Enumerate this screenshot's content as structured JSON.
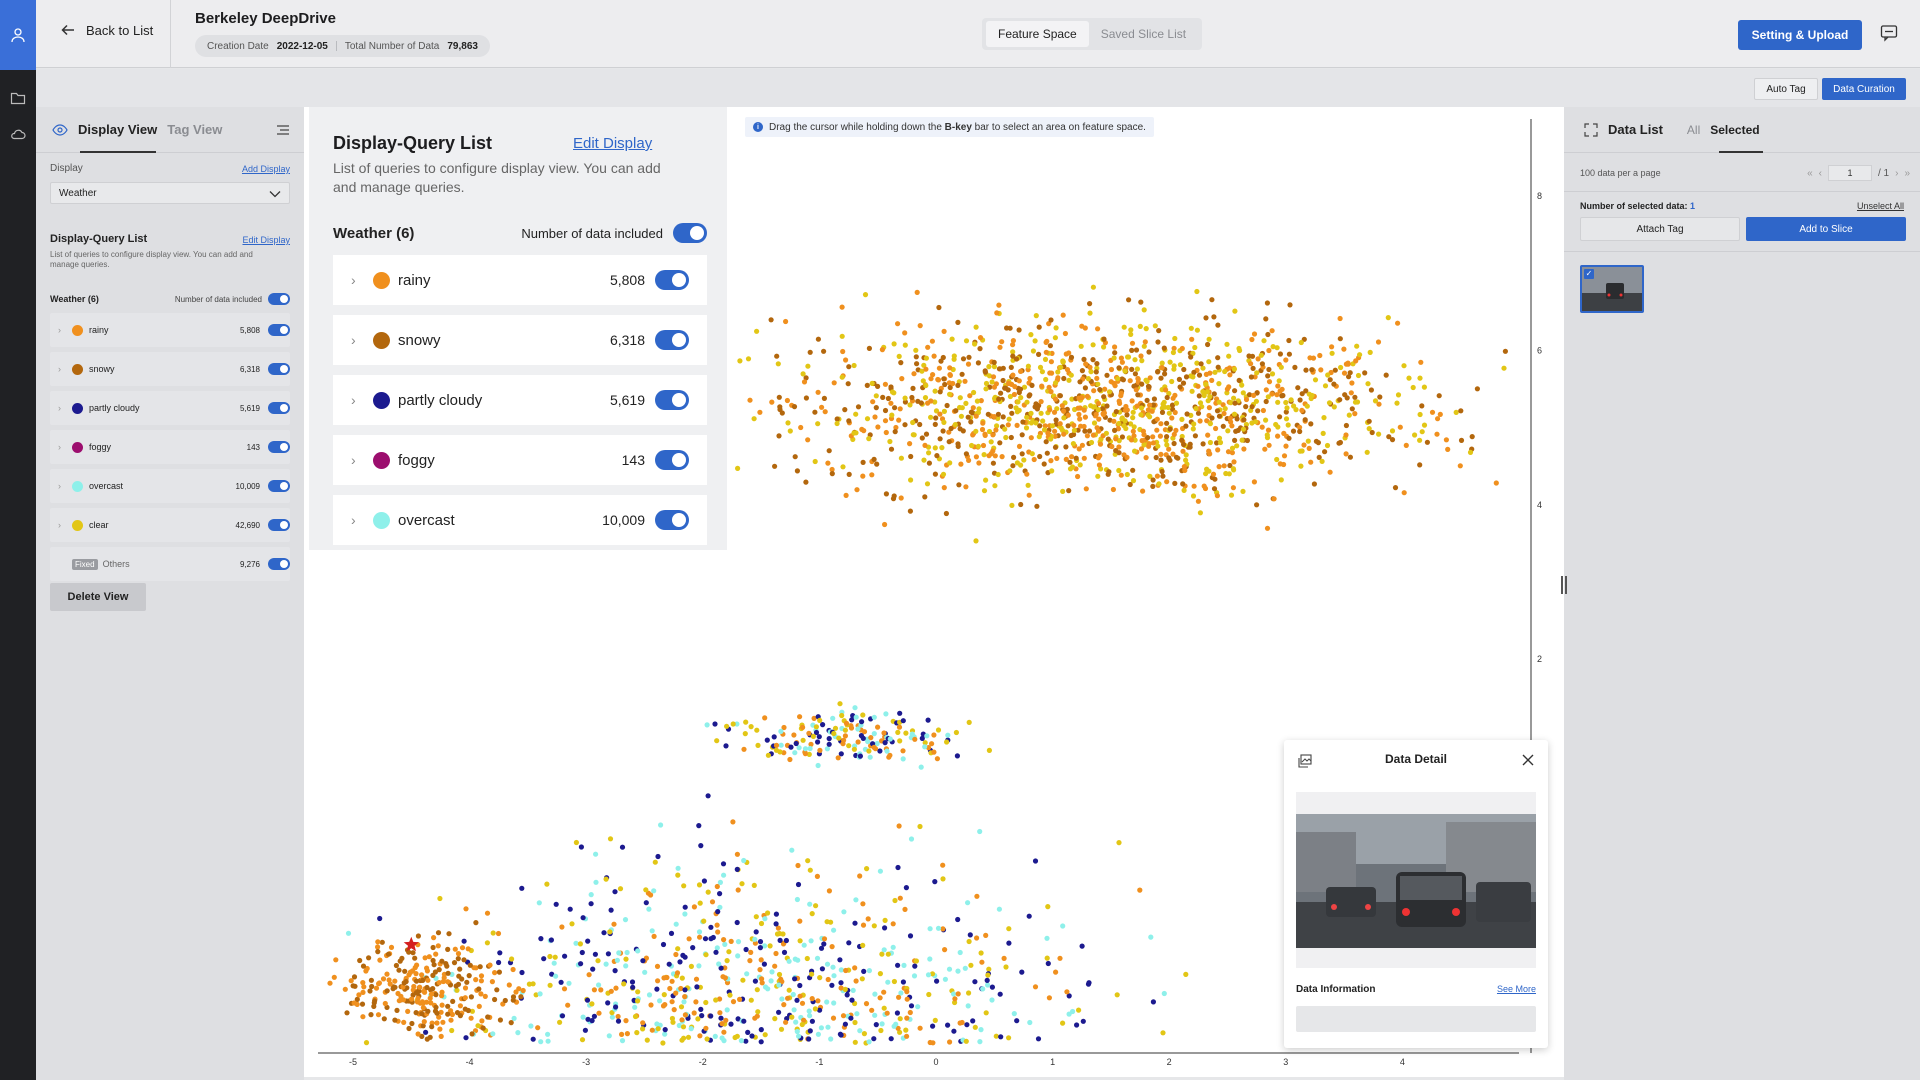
{
  "header": {
    "back_label": "Back to List",
    "project_title": "Berkeley DeepDrive",
    "creation_date_label": "Creation Date",
    "creation_date": "2022-12-05",
    "total_label": "Total Number of Data",
    "total_value": "79,863",
    "tabs": [
      {
        "label": "Feature Space",
        "active": true
      },
      {
        "label": "Saved Slice List",
        "active": false
      }
    ],
    "upload_label": "Setting & Upload"
  },
  "subbar": {
    "auto_tag_label": "Auto Tag",
    "curation_label": "Data Curation"
  },
  "sidebar": {
    "tabs": [
      "Display View",
      "Tag View"
    ],
    "display_label": "Display",
    "add_display_link": "Add Display",
    "selected_display": "Weather",
    "section_title": "Display-Query List",
    "edit_display_link": "Edit Display",
    "section_desc": "List of queries to configure display view. You can add and manage queries.",
    "group_title": "Weather (6)",
    "group_count_label": "Number of data included",
    "items": [
      {
        "label": "rainy",
        "count": "5,808",
        "color": "#f0901e"
      },
      {
        "label": "snowy",
        "count": "6,318",
        "color": "#b3670d"
      },
      {
        "label": "partly cloudy",
        "count": "5,619",
        "color": "#1c1a8f"
      },
      {
        "label": "foggy",
        "count": "143",
        "color": "#9c0e6e"
      },
      {
        "label": "overcast",
        "count": "10,009",
        "color": "#8ef0ea"
      },
      {
        "label": "clear",
        "count": "42,690",
        "color": "#e2c615"
      }
    ],
    "others": {
      "badge": "Fixed",
      "label": "Others",
      "count": "9,276"
    },
    "delete_label": "Delete View"
  },
  "overlay": {
    "title": "Display-Query List",
    "edit_link": "Edit Display",
    "desc": "List of queries to configure display view. You can add and manage queries.",
    "group_title": "Weather (6)",
    "group_count_label": "Number of data included",
    "items": [
      {
        "label": "rainy",
        "count": "5,808",
        "color": "#f0901e"
      },
      {
        "label": "snowy",
        "count": "6,318",
        "color": "#b3670d"
      },
      {
        "label": "partly cloudy",
        "count": "5,619",
        "color": "#1c1a8f"
      },
      {
        "label": "foggy",
        "count": "143",
        "color": "#9c0e6e"
      },
      {
        "label": "overcast",
        "count": "10,009",
        "color": "#8ef0ea"
      }
    ]
  },
  "hint": {
    "pre": "Drag the cursor while holding down the ",
    "key": "B-key",
    "post": " bar to select an area on feature space."
  },
  "chart_data": {
    "type": "scatter",
    "title": "",
    "xlabel": "",
    "ylabel": "",
    "xlim": [
      -5.3,
      5
    ],
    "ylim": [
      -3,
      9
    ],
    "x_ticks": [
      "-5",
      "-4",
      "-3",
      "-2",
      "-1",
      "0",
      "1",
      "2",
      "3",
      "4"
    ],
    "y_ticks": [
      "8",
      "6",
      "4",
      "2",
      "0"
    ],
    "clusters": [
      {
        "name": "upper",
        "center": [
          1.5,
          5.3
        ],
        "spread": [
          2.4,
          1.0
        ],
        "mix": [
          "clear",
          "rainy",
          "snowy"
        ]
      },
      {
        "name": "middle",
        "center": [
          -0.8,
          1.0
        ],
        "spread": [
          0.9,
          0.3
        ],
        "mix": [
          "overcast",
          "clear",
          "rainy",
          "partly cloudy"
        ]
      },
      {
        "name": "lower",
        "center": [
          -1.6,
          -3.0
        ],
        "spread": [
          2.4,
          2.0
        ],
        "mix": [
          "partly cloudy",
          "overcast",
          "clear",
          "rainy"
        ]
      },
      {
        "name": "left",
        "center": [
          -4.4,
          -2.3
        ],
        "spread": [
          0.6,
          0.6
        ],
        "mix": [
          "rainy",
          "snowy"
        ]
      }
    ],
    "marker": {
      "label": "selected-point",
      "x": -4.5,
      "y": -1.7
    }
  },
  "detail": {
    "title": "Data Detail",
    "info_label": "Data Information",
    "see_more": "See More"
  },
  "right_panel": {
    "title": "Data List",
    "tabs": [
      {
        "label": "All",
        "active": false
      },
      {
        "label": "Selected",
        "active": true
      }
    ],
    "per_page": "100 data per a page",
    "page_current": "1",
    "page_total": "/ 1",
    "selected_label": "Number of selected data:",
    "selected_count": "1",
    "unselect_all": "Unselect All",
    "attach_tag": "Attach Tag",
    "add_to_slice": "Add to Slice"
  },
  "colors": {
    "accent": "#2f66c9",
    "rainy": "#f0901e",
    "snowy": "#b3670d",
    "partly_cloudy": "#1c1a8f",
    "foggy": "#9c0e6e",
    "overcast": "#8ef0ea",
    "clear": "#e2c615"
  }
}
